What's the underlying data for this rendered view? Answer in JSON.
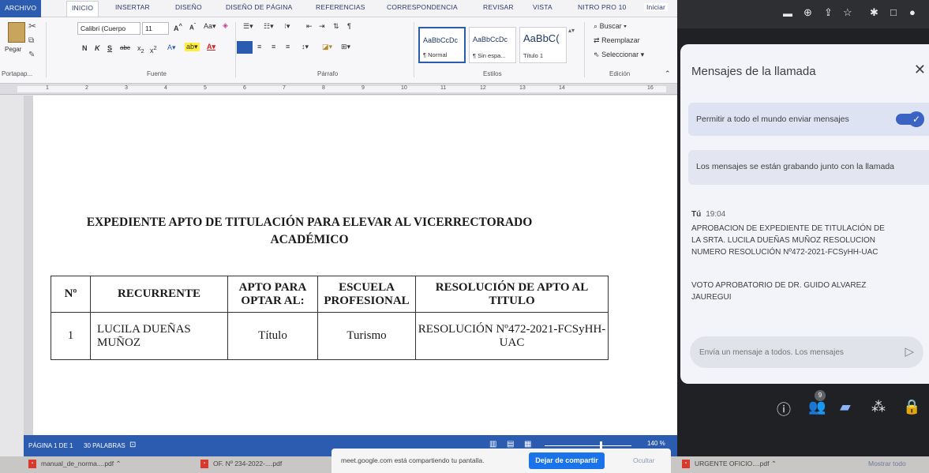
{
  "word": {
    "tabs": [
      "ARCHIVO",
      "INICIO",
      "INSERTAR",
      "DISEÑO",
      "DISEÑO DE PÁGINA",
      "REFERENCIAS",
      "CORRESPONDENCIA",
      "REVISAR",
      "VISTA",
      "NITRO PRO 10",
      "Iniciar"
    ],
    "ribbon": {
      "paste_label": "Pegar",
      "clipboard_label": "Portapap...",
      "font_name": "Calibri (Cuerpo",
      "font_size": "11",
      "font_group_label": "Fuente",
      "paragraph_group_label": "Párrafo",
      "styles_group_label": "Estilos",
      "editing_group_label": "Edición",
      "styles": [
        {
          "sample": "AaBbCcDc",
          "name": "¶ Normal"
        },
        {
          "sample": "AaBbCcDc",
          "name": "¶ Sin espa..."
        },
        {
          "sample": "AaBbC(",
          "name": "Título 1"
        }
      ],
      "find": "Buscar",
      "replace": "Reemplazar",
      "select": "Seleccionar"
    },
    "ruler_numbers": [
      "1",
      "2",
      "3",
      "4",
      "5",
      "6",
      "7",
      "8",
      "9",
      "10",
      "11",
      "12",
      "13",
      "14",
      "16"
    ],
    "document": {
      "title_line1": "EXPEDIENTE  APTO DE TITULACIÓN PARA ELEVAR AL VICERRECTORADO",
      "title_line2": "ACADÉMICO",
      "table": {
        "headers": [
          "Nº",
          "RECURRENTE",
          "APTO PARA OPTAR AL:",
          "ESCUELA PROFESIONAL",
          "RESOLUCIÓN DE APTO AL TITULO"
        ],
        "rows": [
          [
            "1",
            "LUCILA DUEÑAS MUÑOZ",
            "Título",
            "Turismo",
            "RESOLUCIÓN Nº472-2021-FCSyHH-UAC"
          ]
        ]
      }
    },
    "status": {
      "page": "PÁGINA 1 DE 1",
      "words": "30 PALABRAS",
      "zoom": "140 %"
    }
  },
  "meet": {
    "panel_title": "Mensajes de la llamada",
    "allow_label": "Permitir a todo el mundo enviar mensajes",
    "allow_enabled": true,
    "recording_note": "Los mensajes se están grabando junto con la llamada",
    "message": {
      "sender": "Tú",
      "time": "19:04",
      "lines": [
        "APROBACION DE EXPEDIENTE DE TITULACIÓN DE",
        "LA SRTA. LUCILA DUEÑAS MUÑOZ RESOLUCION",
        "NUMERO RESOLUCIÓN Nº472-2021-FCSyHH-UAC"
      ],
      "lines2": [
        "VOTO APROBATORIO DE DR. GUIDO ALVAREZ",
        "JAUREGUI"
      ]
    },
    "input_placeholder": "Envía un mensaje a todos. Los mensajes",
    "participants_badge": "9"
  },
  "share_bar": {
    "text": "meet.google.com está compartiendo tu pantalla.",
    "stop": "Dejar de compartir",
    "hide": "Ocultar"
  },
  "downloads": [
    "manual_de_norma....pdf",
    "OF. Nº 234-2022-....pdf",
    "URGENTE OFICIO....pdf"
  ],
  "show_all": "Mostrar todo"
}
